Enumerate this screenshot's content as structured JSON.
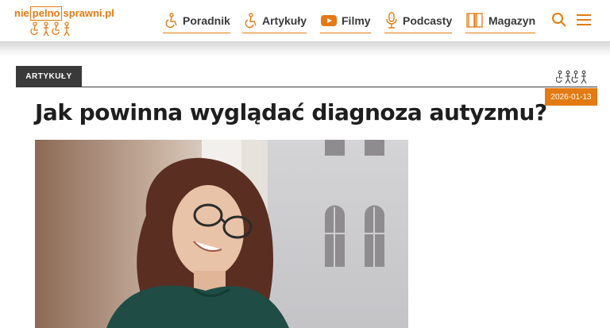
{
  "brand": {
    "logo_part1": "nie",
    "logo_part2": "pelno",
    "logo_part3": "sprawni.pl"
  },
  "nav": {
    "items": [
      {
        "label": "Poradnik",
        "icon": "wheelchair-icon"
      },
      {
        "label": "Artykuły",
        "icon": "wheelchair-icon"
      },
      {
        "label": "Filmy",
        "icon": "youtube-icon"
      },
      {
        "label": "Podcasty",
        "icon": "microphone-icon"
      },
      {
        "label": "Magazyn",
        "icon": "magazine-icon"
      }
    ],
    "search_icon": "search-icon",
    "menu_icon": "hamburger-menu-icon"
  },
  "article": {
    "category": "ARTYKUŁY",
    "date": "2026-01-13",
    "title": "Jak powinna wyglądać diagnoza autyzmu?"
  },
  "colors": {
    "accent": "#e47a12",
    "dark": "#3a3a3a"
  }
}
